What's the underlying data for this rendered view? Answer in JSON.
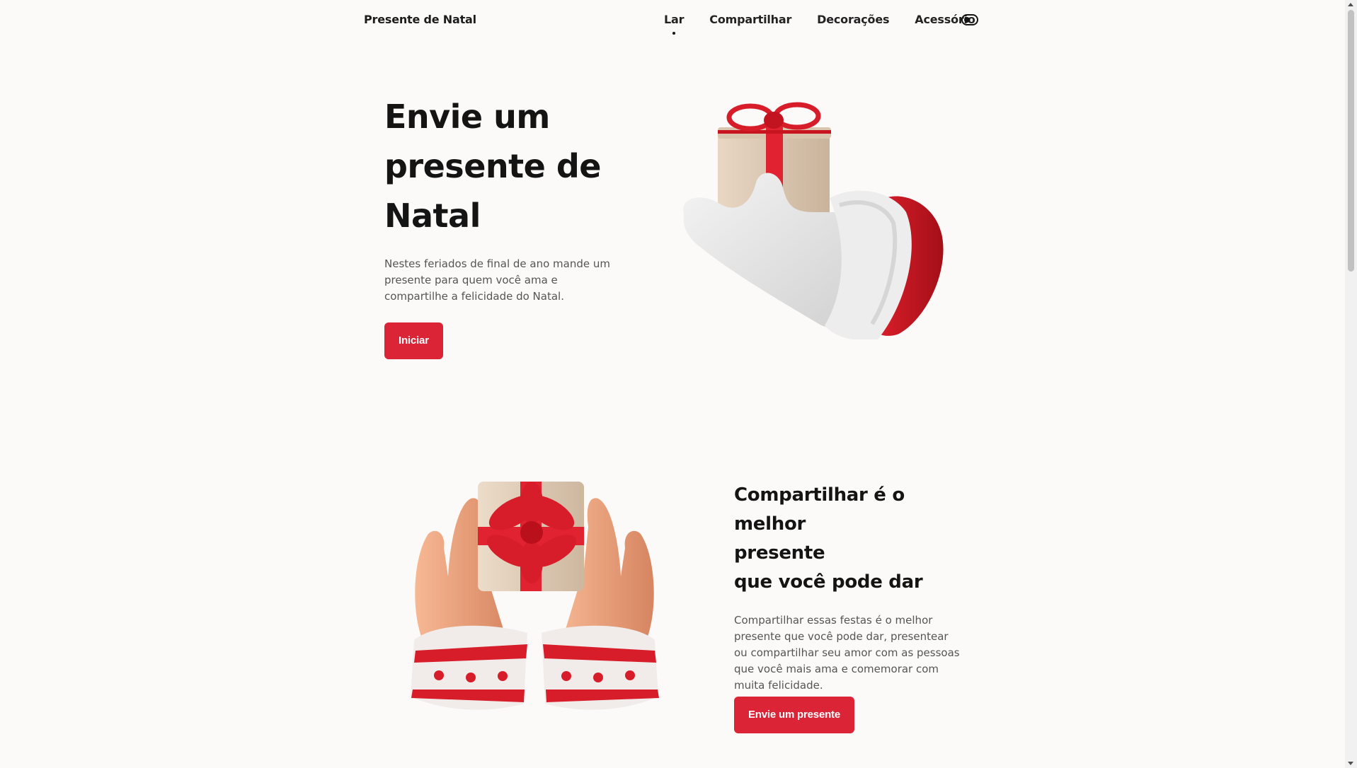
{
  "header": {
    "logo": "Presente de Natal",
    "nav": [
      {
        "label": "Lar",
        "active": true
      },
      {
        "label": "Compartilhar"
      },
      {
        "label": "Decorações"
      },
      {
        "label": "Acessório"
      }
    ],
    "theme_toggle_icon": "toggle-switch-icon"
  },
  "hero": {
    "title_lines": [
      "Envie um",
      "presente de",
      "Natal"
    ],
    "description": "Nestes feriados de final de ano mande um presente para quem você ama e compartilhe a felicidade do Natal.",
    "button_label": "Iniciar",
    "image": "santa-glove-holding-gift"
  },
  "share": {
    "title_lines": [
      "Compartilhar é o melhor",
      "presente",
      "que você pode dar"
    ],
    "description": "Compartilhar essas festas é o melhor presente que você pode dar, presentear ou compartilhar seu amor com as pessoas que você mais ama e comemorar com muita felicidade.",
    "button_label": "Envie um presente",
    "image": "hands-in-sweater-holding-gift"
  },
  "colors": {
    "accent": "#dc2437",
    "background": "#fcfaf9",
    "text": "#141414"
  }
}
